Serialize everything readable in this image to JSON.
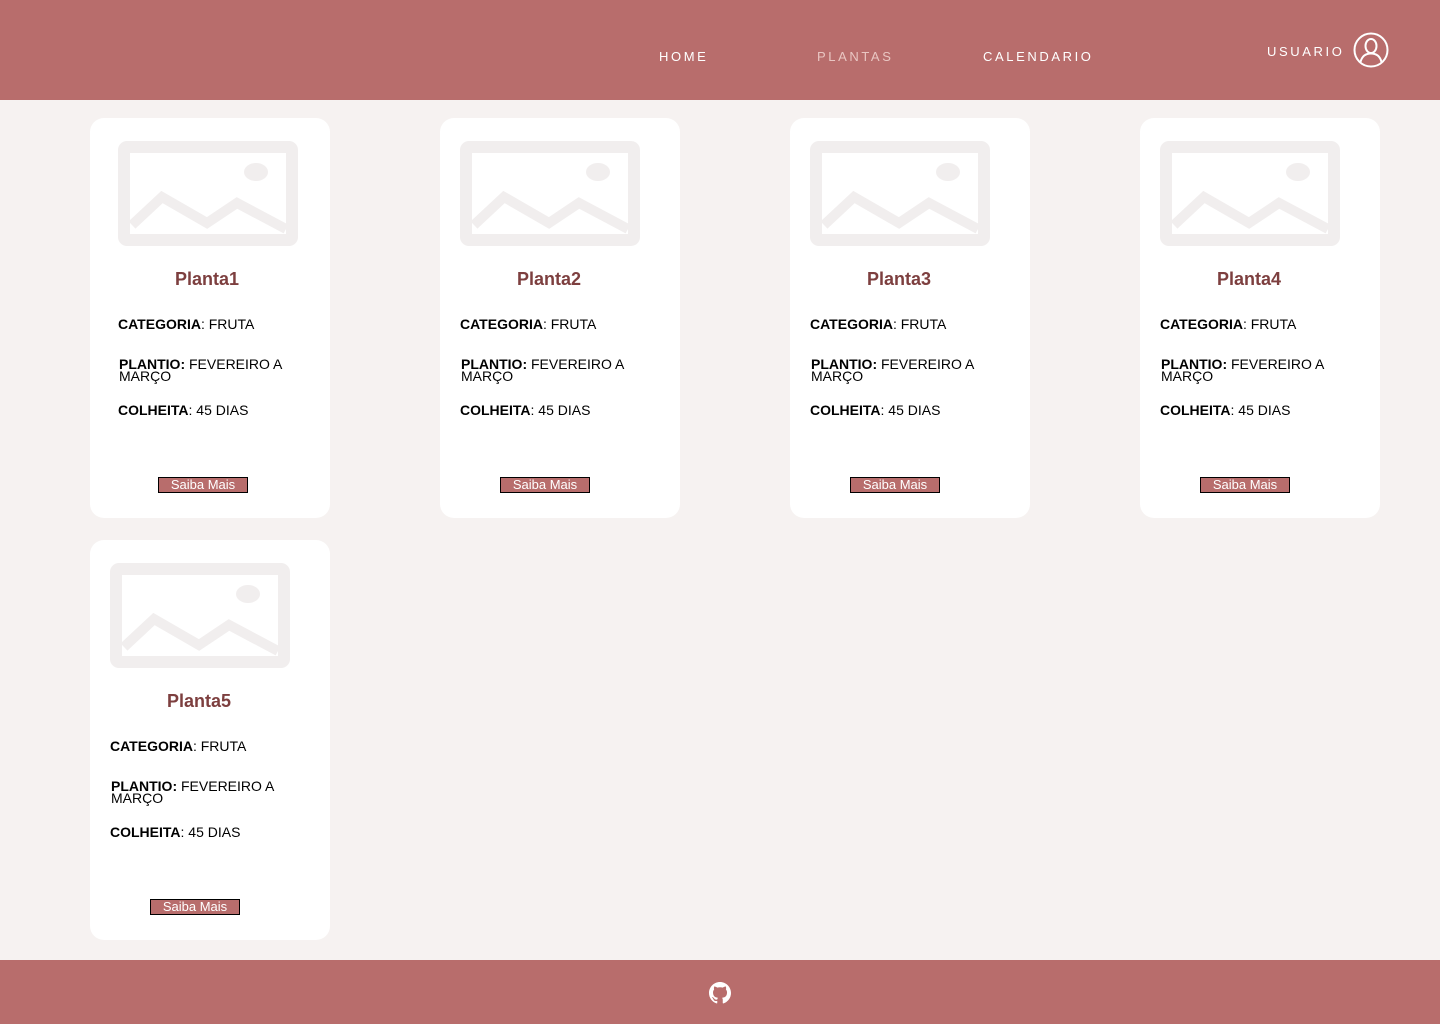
{
  "nav": {
    "home": "HOME",
    "plantas": "PLANTAS",
    "calendario": "CALENDARIO",
    "user": "USUARIO"
  },
  "labels": {
    "categoria": "CATEGORIA",
    "plantio": "PLANTIO:",
    "colheita": "COLHEITA"
  },
  "cards": [
    {
      "title": "Planta1",
      "categoria": ": FRUTA",
      "plantio": " FEVEREIRO A MARÇO",
      "colheita": ": 45 DIAS",
      "button": "Saiba Mais"
    },
    {
      "title": "Planta2",
      "categoria": ": FRUTA",
      "plantio": " FEVEREIRO A MARÇO",
      "colheita": ": 45 DIAS",
      "button": "Saiba Mais"
    },
    {
      "title": "Planta3",
      "categoria": ": FRUTA",
      "plantio": " FEVEREIRO A MARÇO",
      "colheita": ": 45 DIAS",
      "button": "Saiba Mais"
    },
    {
      "title": "Planta4",
      "categoria": ": FRUTA",
      "plantio": " FEVEREIRO A MARÇO",
      "colheita": ": 45 DIAS",
      "button": "Saiba Mais"
    },
    {
      "title": "Planta5",
      "categoria": ": FRUTA",
      "plantio": " FEVEREIRO A MARÇO",
      "colheita": ": 45 DIAS",
      "button": "Saiba Mais"
    }
  ],
  "icons": {
    "user": "user-circle-icon",
    "placeholder": "image-placeholder-icon",
    "footer": "github-icon"
  },
  "colors": {
    "brand": "#b86d6c",
    "title": "#7d3f3f",
    "background": "#f6f2f1",
    "nav_active": "#e9c6c2"
  }
}
